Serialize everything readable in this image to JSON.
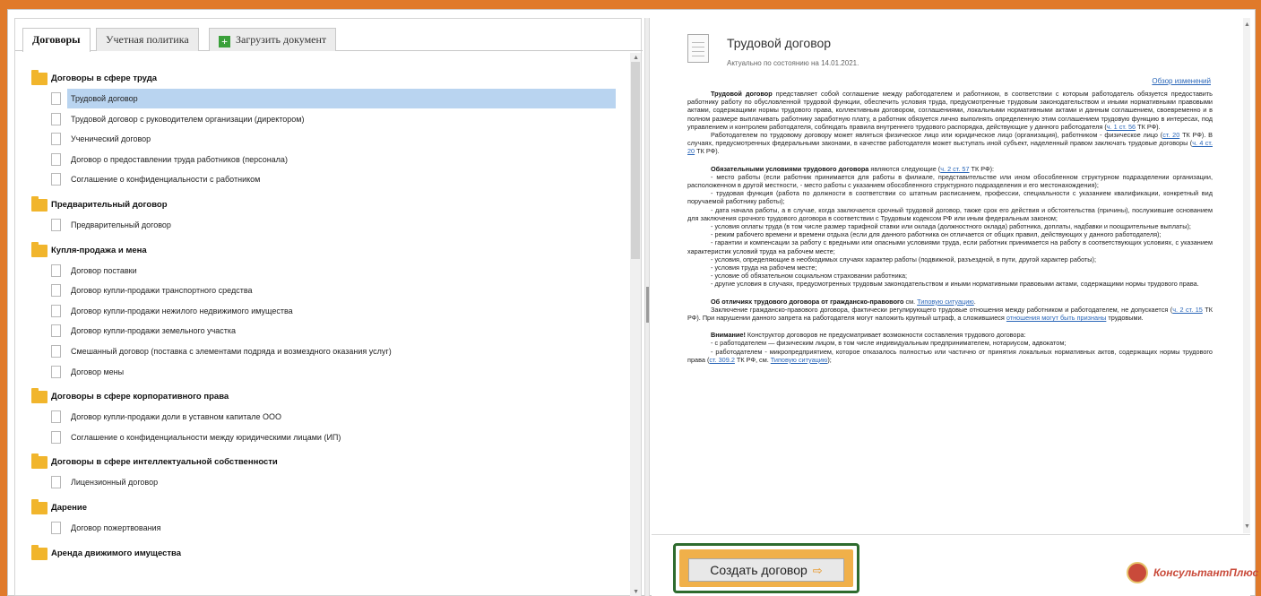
{
  "tabs": {
    "contracts": "Договоры",
    "accounting": "Учетная политика",
    "upload": "Загрузить документ"
  },
  "groups": [
    {
      "title": "Договоры в сфере труда",
      "items": [
        "Трудовой договор",
        "Трудовой договор с руководителем организации (директором)",
        "Ученический договор",
        "Договор о предоставлении труда работников (персонала)",
        "Соглашение о конфиденциальности с работником"
      ]
    },
    {
      "title": "Предварительный договор",
      "items": [
        "Предварительный договор"
      ]
    },
    {
      "title": "Купля-продажа и мена",
      "items": [
        "Договор поставки",
        "Договор купли-продажи транспортного средства",
        "Договор купли-продажи нежилого недвижимого имущества",
        "Договор купли-продажи земельного участка",
        "Смешанный договор (поставка с элементами подряда и возмездного оказания услуг)",
        "Договор мены"
      ]
    },
    {
      "title": "Договоры в сфере корпоративного права",
      "items": [
        "Договор купли-продажи доли в уставном капитале ООО",
        "Соглашение о конфиденциальности между юридическими лицами (ИП)"
      ]
    },
    {
      "title": "Договоры в сфере интеллектуальной собственности",
      "items": [
        "Лицензионный договор"
      ]
    },
    {
      "title": "Дарение",
      "items": [
        "Договор пожертвования"
      ]
    },
    {
      "title": "Аренда движимого имущества",
      "items": []
    }
  ],
  "document": {
    "title": "Трудовой договор",
    "actual": "Актуально по состоянию на 14.01.2021.",
    "review_link": "Обзор изменений",
    "p1_bold": "Трудовой договор",
    "p1": " представляет собой соглашение между работодателем и работником, в соответствии с которым работодатель обязуется предоставить работнику работу по обусловленной трудовой функции, обеспечить условия труда, предусмотренные трудовым законодательством и иными нормативными правовыми актами, содержащими нормы трудового права, коллективным договором, соглашениями, локальными нормативными актами и данным соглашением, своевременно и в полном размере выплачивать работнику заработную плату, а работник обязуется лично выполнять определенную этим соглашением трудовую функцию в интересах, под управлением и контролем работодателя, соблюдать правила внутреннего трудового распорядка, действующие у данного работодателя (",
    "p1_link": "ч. 1 ст. 56",
    "p1_end": " ТК РФ).",
    "p2": "Работодателем по трудовому договору может являться физическое лицо или юридическое лицо (организация), работником - физическое лицо (",
    "p2_link1": "ст. 20",
    "p2_mid": " ТК РФ). В случаях, предусмотренных федеральными законами, в качестве работодателя может выступать иной субъект, наделенный правом заключать трудовые договоры (",
    "p2_link2": "ч. 4 ст. 20",
    "p2_end": " ТК РФ).",
    "p3_bold": "Обязательными условиями трудового договора",
    "p3": " являются следующие (",
    "p3_link": "ч. 2 ст. 57",
    "p3_end": " ТК РФ):",
    "l1": "- место работы (если работник принимается для работы в филиале, представительстве или ином обособленном структурном подразделении организации, расположенном в другой местности, - место работы с указанием обособленного структурного подразделения и его местонахождения);",
    "l2": "- трудовая функция (работа по должности в соответствии со штатным расписанием, профессии, специальности с указанием квалификации, конкретный вид поручаемой работнику работы);",
    "l3": "- дата начала работы, а в случае, когда заключается срочный трудовой договор, также срок его действия и обстоятельства (причины), послужившие основанием для заключения срочного трудового договора в соответствии с Трудовым кодексом РФ или иным федеральным законом;",
    "l4": "- условия оплаты труда (в том числе размер тарифной ставки или оклада (должностного оклада) работника, доплаты, надбавки и поощрительные выплаты);",
    "l5": "- режим рабочего времени и времени отдыха (если для данного работника он отличается от общих правил, действующих у данного работодателя);",
    "l6": "- гарантии и компенсации за работу с вредными или опасными условиями труда, если работник принимается на работу в соответствующих условиях, с указанием характеристик условий труда на рабочем месте;",
    "l7": "- условия, определяющие в необходимых случаях характер работы (подвижной, разъездной, в пути, другой характер работы);",
    "l8": "- условия труда на рабочем месте;",
    "l9": "- условие об обязательном социальном страховании работника;",
    "l10": "- другие условия в случаях, предусмотренных трудовым законодательством и иными нормативными правовыми актами, содержащими нормы трудового права.",
    "p4_bold": "Об отличиях трудового договора от гражданско-правового",
    "p4": " см. ",
    "p4_link": "Типовую ситуацию",
    "p4_end": ".",
    "p5": "Заключение гражданско-правового договора, фактически регулирующего трудовые отношения между работником и работодателем, не допускается (",
    "p5_link": "ч. 2 ст. 15",
    "p5_mid": " ТК РФ). При нарушении данного запрета на работодателя могут наложить крупный штраф, а сложившиеся ",
    "p5_link2": "отношения могут быть признаны",
    "p5_end": " трудовыми.",
    "p6_bold": "Внимание!",
    "p6": " Конструктор договоров не предусматривает возможности составления трудового договора:",
    "l11": "- с работодателем — физическим лицом, в том числе индивидуальным предпринимателем, нотариусом, адвокатом;",
    "l12a": "- работодателем - микропредприятием, которое отказалось полностью или частично от принятия локальных нормативных актов, содержащих нормы трудового права (",
    "l12_link": "ст. 309.2",
    "l12b": " ТК РФ, см. ",
    "l12_link2": "Типовую ситуацию",
    "l12c": ");"
  },
  "create_button": "Создать договор",
  "logo_text": "КонсультантПлюс"
}
